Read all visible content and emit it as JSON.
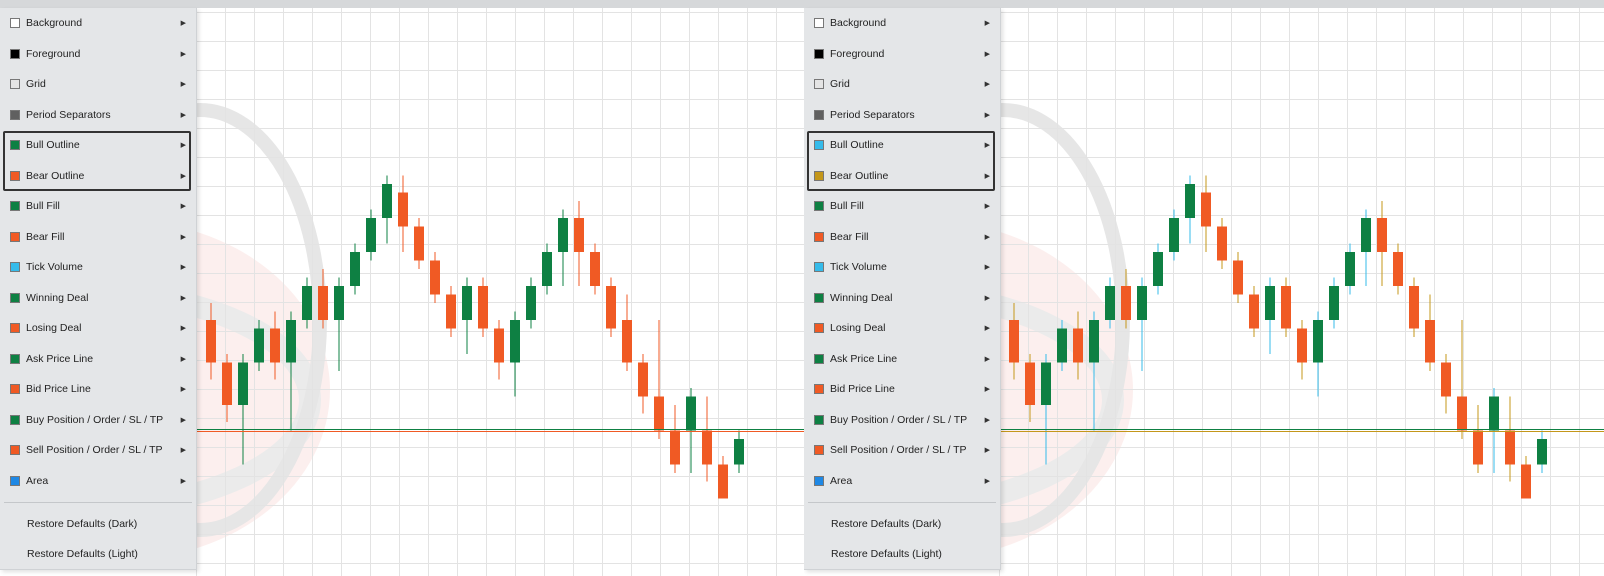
{
  "panels": [
    {
      "id": "left",
      "menu": {
        "items": [
          {
            "label": "Background",
            "color": "#ffffff"
          },
          {
            "label": "Foreground",
            "color": "#000000"
          },
          {
            "label": "Grid",
            "color": "#e4e4e4"
          },
          {
            "label": "Period Separators",
            "color": "#606060"
          },
          {
            "label": "Bull Outline",
            "color": "#0e8043"
          },
          {
            "label": "Bear Outline",
            "color": "#f05a24"
          },
          {
            "label": "Bull Fill",
            "color": "#0e8043"
          },
          {
            "label": "Bear Fill",
            "color": "#f05a24"
          },
          {
            "label": "Tick Volume",
            "color": "#35bbea"
          },
          {
            "label": "Winning Deal",
            "color": "#0e8043"
          },
          {
            "label": "Losing Deal",
            "color": "#f05a24"
          },
          {
            "label": "Ask Price Line",
            "color": "#0e8043"
          },
          {
            "label": "Bid Price Line",
            "color": "#f05a24"
          },
          {
            "label": "Buy Position / Order / SL / TP",
            "color": "#0e8043"
          },
          {
            "label": "Sell Position / Order / SL / TP",
            "color": "#f05a24"
          },
          {
            "label": "Area",
            "color": "#1e88e5"
          }
        ],
        "restore_dark": "Restore Defaults (Dark)",
        "restore_light": "Restore Defaults (Light)"
      },
      "colors": {
        "bull_fill": "#0e8043",
        "bear_fill": "#f05a24",
        "bull_outline": "#0e8043",
        "bear_outline": "#f05a24",
        "ask_line": "#0e8043",
        "bid_line": "#f05a24"
      }
    },
    {
      "id": "right",
      "menu": {
        "items": [
          {
            "label": "Background",
            "color": "#ffffff"
          },
          {
            "label": "Foreground",
            "color": "#000000"
          },
          {
            "label": "Grid",
            "color": "#e4e4e4"
          },
          {
            "label": "Period Separators",
            "color": "#606060"
          },
          {
            "label": "Bull Outline",
            "color": "#35bbea"
          },
          {
            "label": "Bear Outline",
            "color": "#c4971a"
          },
          {
            "label": "Bull Fill",
            "color": "#0e8043"
          },
          {
            "label": "Bear Fill",
            "color": "#f05a24"
          },
          {
            "label": "Tick Volume",
            "color": "#35bbea"
          },
          {
            "label": "Winning Deal",
            "color": "#0e8043"
          },
          {
            "label": "Losing Deal",
            "color": "#f05a24"
          },
          {
            "label": "Ask Price Line",
            "color": "#0e8043"
          },
          {
            "label": "Bid Price Line",
            "color": "#f05a24"
          },
          {
            "label": "Buy Position / Order / SL / TP",
            "color": "#0e8043"
          },
          {
            "label": "Sell Position / Order / SL / TP",
            "color": "#f05a24"
          },
          {
            "label": "Area",
            "color": "#1e88e5"
          }
        ],
        "restore_dark": "Restore Defaults (Dark)",
        "restore_light": "Restore Defaults (Light)"
      },
      "colors": {
        "bull_fill": "#0e8043",
        "bear_fill": "#f05a24",
        "bull_outline": "#35bbea",
        "bear_outline": "#c4971a",
        "ask_line": "#0e8043",
        "bid_line": "#c4971a"
      }
    }
  ],
  "highlighted_items": [
    "Bull Outline",
    "Bear Outline"
  ],
  "chart_data": {
    "type": "candlestick",
    "candles": [
      {
        "o": 16,
        "c": 11,
        "h": 18,
        "l": 9
      },
      {
        "o": 11,
        "c": 6,
        "h": 12,
        "l": 4
      },
      {
        "o": 6,
        "c": 11,
        "h": 12,
        "l": -1
      },
      {
        "o": 11,
        "c": 15,
        "h": 16,
        "l": 10
      },
      {
        "o": 15,
        "c": 11,
        "h": 17,
        "l": 9
      },
      {
        "o": 11,
        "c": 16,
        "h": 17,
        "l": 3
      },
      {
        "o": 16,
        "c": 20,
        "h": 21,
        "l": 15
      },
      {
        "o": 20,
        "c": 16,
        "h": 22,
        "l": 15
      },
      {
        "o": 16,
        "c": 20,
        "h": 21,
        "l": 10
      },
      {
        "o": 20,
        "c": 24,
        "h": 25,
        "l": 19
      },
      {
        "o": 24,
        "c": 28,
        "h": 29,
        "l": 23
      },
      {
        "o": 28,
        "c": 32,
        "h": 33,
        "l": 25
      },
      {
        "o": 31,
        "c": 27,
        "h": 33,
        "l": 24
      },
      {
        "o": 27,
        "c": 23,
        "h": 28,
        "l": 22
      },
      {
        "o": 23,
        "c": 19,
        "h": 24,
        "l": 18
      },
      {
        "o": 19,
        "c": 15,
        "h": 20,
        "l": 14
      },
      {
        "o": 16,
        "c": 20,
        "h": 21,
        "l": 12
      },
      {
        "o": 20,
        "c": 15,
        "h": 21,
        "l": 14
      },
      {
        "o": 15,
        "c": 11,
        "h": 16,
        "l": 9
      },
      {
        "o": 11,
        "c": 16,
        "h": 17,
        "l": 7
      },
      {
        "o": 16,
        "c": 20,
        "h": 21,
        "l": 15
      },
      {
        "o": 20,
        "c": 24,
        "h": 25,
        "l": 19
      },
      {
        "o": 24,
        "c": 28,
        "h": 29,
        "l": 20
      },
      {
        "o": 28,
        "c": 24,
        "h": 30,
        "l": 20
      },
      {
        "o": 24,
        "c": 20,
        "h": 25,
        "l": 19
      },
      {
        "o": 20,
        "c": 15,
        "h": 21,
        "l": 14
      },
      {
        "o": 16,
        "c": 11,
        "h": 19,
        "l": 10
      },
      {
        "o": 11,
        "c": 7,
        "h": 12,
        "l": 5
      },
      {
        "o": 7,
        "c": 3,
        "h": 16,
        "l": 2
      },
      {
        "o": 3,
        "c": -1,
        "h": 6,
        "l": -2
      },
      {
        "o": 3,
        "c": 7,
        "h": 8,
        "l": -2
      },
      {
        "o": 3,
        "c": -1,
        "h": 7,
        "l": -3
      },
      {
        "o": -1,
        "c": -5,
        "h": 0,
        "l": -5
      },
      {
        "o": -1,
        "c": 2,
        "h": 3,
        "l": -2
      }
    ],
    "price_line": 3
  }
}
